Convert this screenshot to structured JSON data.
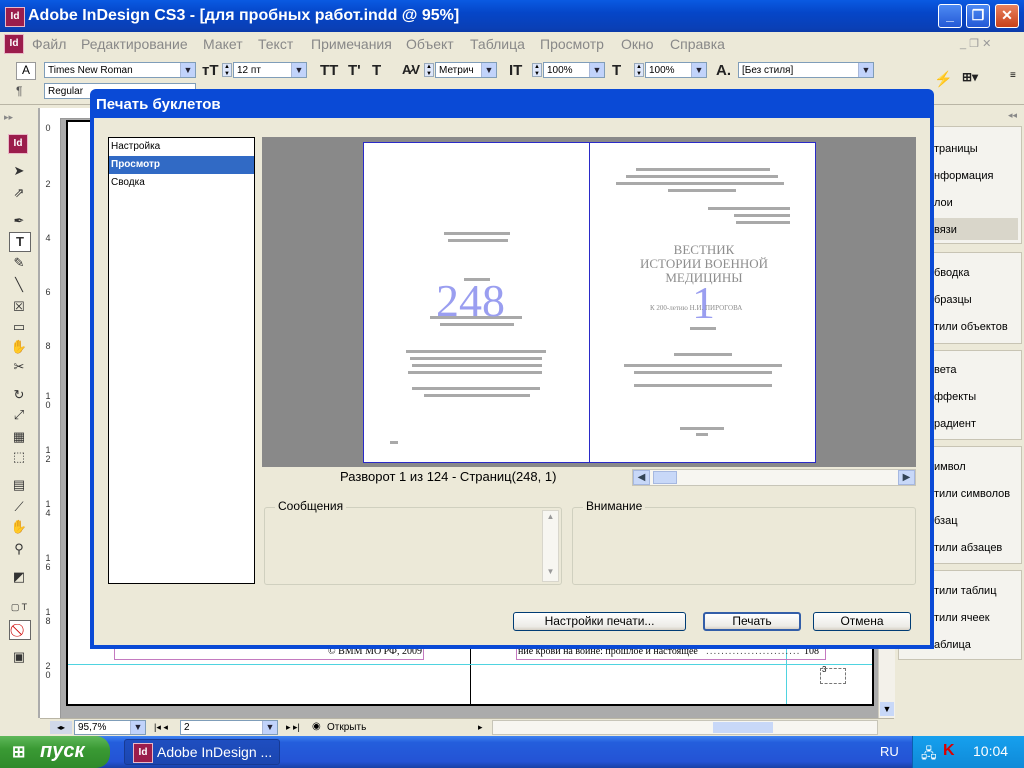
{
  "window": {
    "title": "Adobe InDesign CS3 - [для пробных работ.indd @ 95%]",
    "app_icon": "Id"
  },
  "menu": [
    "Файл",
    "Редактирование",
    "Макет",
    "Текст",
    "Примечания",
    "Объект",
    "Таблица",
    "Просмотр",
    "Окно",
    "Справка"
  ],
  "control_panel": {
    "font_family": "Times New Roman",
    "font_style": "Regular",
    "font_size": "12 пт",
    "kerning": "Метрич",
    "vertical_scale": "100%",
    "horizontal_scale": "100%",
    "style": "[Без стиля]"
  },
  "ruler_numbers": [
    "0",
    "2",
    "4",
    "6",
    "8",
    "1 0",
    "1 2",
    "1 4",
    "1 6",
    "1 8",
    "2 0"
  ],
  "panels": [
    {
      "items": [
        "траницы",
        "нформация",
        "лои",
        "вязи"
      ]
    },
    {
      "items": [
        "бводка",
        "бразцы",
        "тили объектов"
      ]
    },
    {
      "items": [
        "вета",
        "ффекты",
        "радиент"
      ]
    },
    {
      "items": [
        "имвол",
        "тили символов",
        "бзац",
        "тили абзацев"
      ]
    },
    {
      "items": [
        "тили таблиц",
        "тили ячеек",
        "аблица"
      ]
    }
  ],
  "background_page": {
    "left_footer": "© ВММ МО РФ, 2009",
    "right_line": "ние крови на войне: прошлое и настоящее",
    "right_page": "108",
    "corner_mark": "3"
  },
  "status_bar": {
    "zoom": "95,7%",
    "page": "2",
    "action": "Открыть"
  },
  "dialog": {
    "title": "Печать буклетов",
    "sidebar": [
      {
        "label": "Настройка",
        "selected": false
      },
      {
        "label": "Просмотр",
        "selected": true
      },
      {
        "label": "Сводка",
        "selected": false
      }
    ],
    "preview": {
      "left_page_number": "248",
      "right_page_number": "1",
      "right_title_lines": [
        "ВЕСТНИК",
        "ИСТОРИИ ВОЕННОЙ",
        "МЕДИЦИНЫ"
      ],
      "right_subtitle": "К 200-летию Н.И. ПИРОГОВА"
    },
    "spread_info": "Разворот 1 из 124 - Страниц(248, 1)",
    "messages_label": "Сообщения",
    "warning_label": "Внимание",
    "buttons": {
      "print_settings": "Настройки печати...",
      "print": "Печать",
      "cancel": "Отмена"
    }
  },
  "taskbar": {
    "start": "пуск",
    "task": "Adobe InDesign ...",
    "lang": "RU",
    "clock": "10:04"
  }
}
